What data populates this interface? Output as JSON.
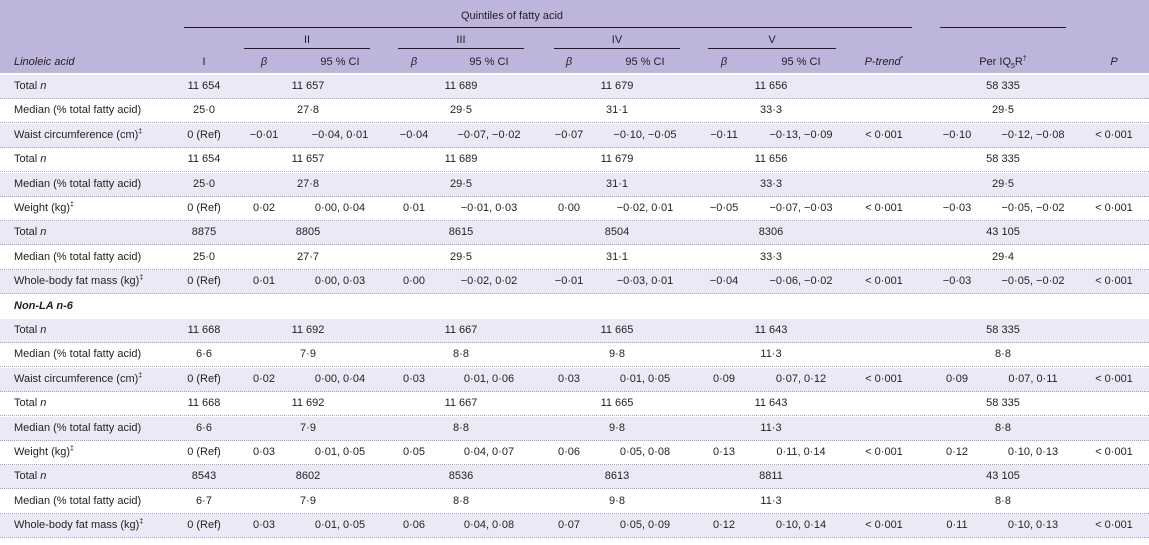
{
  "header": {
    "spanner": "Quintiles of fatty acid",
    "stub": "Linoleic acid",
    "quintiles": [
      "I",
      "II",
      "III",
      "IV",
      "V"
    ],
    "beta": "β",
    "ci": "95 % CI",
    "ptrend": "P-trend",
    "ptrend_mark": "*",
    "periqr": "Per IQ",
    "periqr_sub": "5",
    "periqr_tail": "R",
    "periqr_mark": "†",
    "p": "P"
  },
  "rows": [
    {
      "label": "Total ",
      "label_it": "n",
      "kind": "n",
      "q1": "11 654",
      "q2": "11 657",
      "q3": "11 689",
      "q4": "11 679",
      "q5": "11 656",
      "per": "58 335"
    },
    {
      "label": "Median (% total fatty acid)",
      "kind": "n",
      "q1": "25·0",
      "q2": "27·8",
      "q3": "29·5",
      "q4": "31·1",
      "q5": "33·3",
      "per": "29·5"
    },
    {
      "label": "Waist circumference (cm)",
      "mark": "‡",
      "kind": "b",
      "q1": "0 (Ref)",
      "b2": "−0·01",
      "c2": "−0·04, 0·01",
      "b3": "−0·04",
      "c3": "−0·07, −0·02",
      "b4": "−0·07",
      "c4": "−0·10, −0·05",
      "b5": "−0·11",
      "c5": "−0·13, −0·09",
      "pt": "< 0·001",
      "bp": "−0·10",
      "cp": "−0·12, −0·08",
      "p": "< 0·001"
    },
    {
      "label": "Total ",
      "label_it": "n",
      "kind": "n",
      "q1": "11 654",
      "q2": "11 657",
      "q3": "11 689",
      "q4": "11 679",
      "q5": "11 656",
      "per": "58 335"
    },
    {
      "label": "Median (% total fatty acid)",
      "kind": "n",
      "q1": "25·0",
      "q2": "27·8",
      "q3": "29·5",
      "q4": "31·1",
      "q5": "33·3",
      "per": "29·5"
    },
    {
      "label": "Weight (kg)",
      "mark": "‡",
      "kind": "b",
      "q1": "0 (Ref)",
      "b2": "0·02",
      "c2": "0·00, 0·04",
      "b3": "0·01",
      "c3": "−0·01, 0·03",
      "b4": "0·00",
      "c4": "−0·02, 0·01",
      "b5": "−0·05",
      "c5": "−0·07, −0·03",
      "pt": "< 0·001",
      "bp": "−0·03",
      "cp": "−0·05, −0·02",
      "p": "< 0·001"
    },
    {
      "label": "Total ",
      "label_it": "n",
      "kind": "n",
      "q1": "8875",
      "q2": "8805",
      "q3": "8615",
      "q4": "8504",
      "q5": "8306",
      "per": "43 105"
    },
    {
      "label": "Median (% total fatty acid)",
      "kind": "n",
      "q1": "25·0",
      "q2": "27·7",
      "q3": "29·5",
      "q4": "31·1",
      "q5": "33·3",
      "per": "29·4"
    },
    {
      "label": "Whole-body fat mass (kg)",
      "mark": "‡",
      "kind": "b",
      "q1": "0 (Ref)",
      "b2": "0·01",
      "c2": "0·00, 0·03",
      "b3": "0·00",
      "c3": "−0·02, 0·02",
      "b4": "−0·01",
      "c4": "−0·03, 0·01",
      "b5": "−0·04",
      "c5": "−0·06, −0·02",
      "pt": "< 0·001",
      "bp": "−0·03",
      "cp": "−0·05, −0·02",
      "p": "< 0·001"
    },
    {
      "label": "Non-LA n-6",
      "kind": "section"
    },
    {
      "label": "Total ",
      "label_it": "n",
      "kind": "n",
      "q1": "11 668",
      "q2": "11 692",
      "q3": "11 667",
      "q4": "11 665",
      "q5": "11 643",
      "per": "58 335"
    },
    {
      "label": "Median (% total fatty acid)",
      "kind": "n",
      "q1": "6·6",
      "q2": "7·9",
      "q3": "8·8",
      "q4": "9·8",
      "q5": "11·3",
      "per": "8·8"
    },
    {
      "label": "Waist circumference (cm)",
      "mark": "‡",
      "kind": "b",
      "q1": "0 (Ref)",
      "b2": "0·02",
      "c2": "0·00, 0·04",
      "b3": "0·03",
      "c3": "0·01, 0·06",
      "b4": "0·03",
      "c4": "0·01, 0·05",
      "b5": "0·09",
      "c5": "0·07, 0·12",
      "pt": "< 0·001",
      "bp": "0·09",
      "cp": "0·07, 0·11",
      "p": "< 0·001"
    },
    {
      "label": "Total ",
      "label_it": "n",
      "kind": "n",
      "q1": "11 668",
      "q2": "11 692",
      "q3": "11 667",
      "q4": "11 665",
      "q5": "11 643",
      "per": "58 335"
    },
    {
      "label": "Median (% total fatty acid)",
      "kind": "n",
      "q1": "6·6",
      "q2": "7·9",
      "q3": "8·8",
      "q4": "9·8",
      "q5": "11·3",
      "per": "8·8"
    },
    {
      "label": "Weight (kg)",
      "mark": "‡",
      "kind": "b",
      "q1": "0 (Ref)",
      "b2": "0·03",
      "c2": "0·01, 0·05",
      "b3": "0·05",
      "c3": "0·04, 0·07",
      "b4": "0·06",
      "c4": "0·05, 0·08",
      "b5": "0·13",
      "c5": "0·11, 0·14",
      "pt": "< 0·001",
      "bp": "0·12",
      "cp": "0·10, 0·13",
      "p": "< 0·001"
    },
    {
      "label": "Total ",
      "label_it": "n",
      "kind": "n",
      "q1": "8543",
      "q2": "8602",
      "q3": "8536",
      "q4": "8613",
      "q5": "8811",
      "per": "43 105"
    },
    {
      "label": "Median (% total fatty acid)",
      "kind": "n",
      "q1": "6·7",
      "q2": "7·9",
      "q3": "8·8",
      "q4": "9·8",
      "q5": "11·3",
      "per": "8·8"
    },
    {
      "label": "Whole-body fat mass (kg)",
      "mark": "‡",
      "kind": "b",
      "q1": "0 (Ref)",
      "b2": "0·03",
      "c2": "0·01, 0·05",
      "b3": "0·06",
      "c3": "0·04, 0·08",
      "b4": "0·07",
      "c4": "0·05, 0·09",
      "b5": "0·12",
      "c5": "0·10, 0·14",
      "pt": "< 0·001",
      "bp": "0·11",
      "cp": "0·10, 0·13",
      "p": "< 0·001"
    }
  ]
}
